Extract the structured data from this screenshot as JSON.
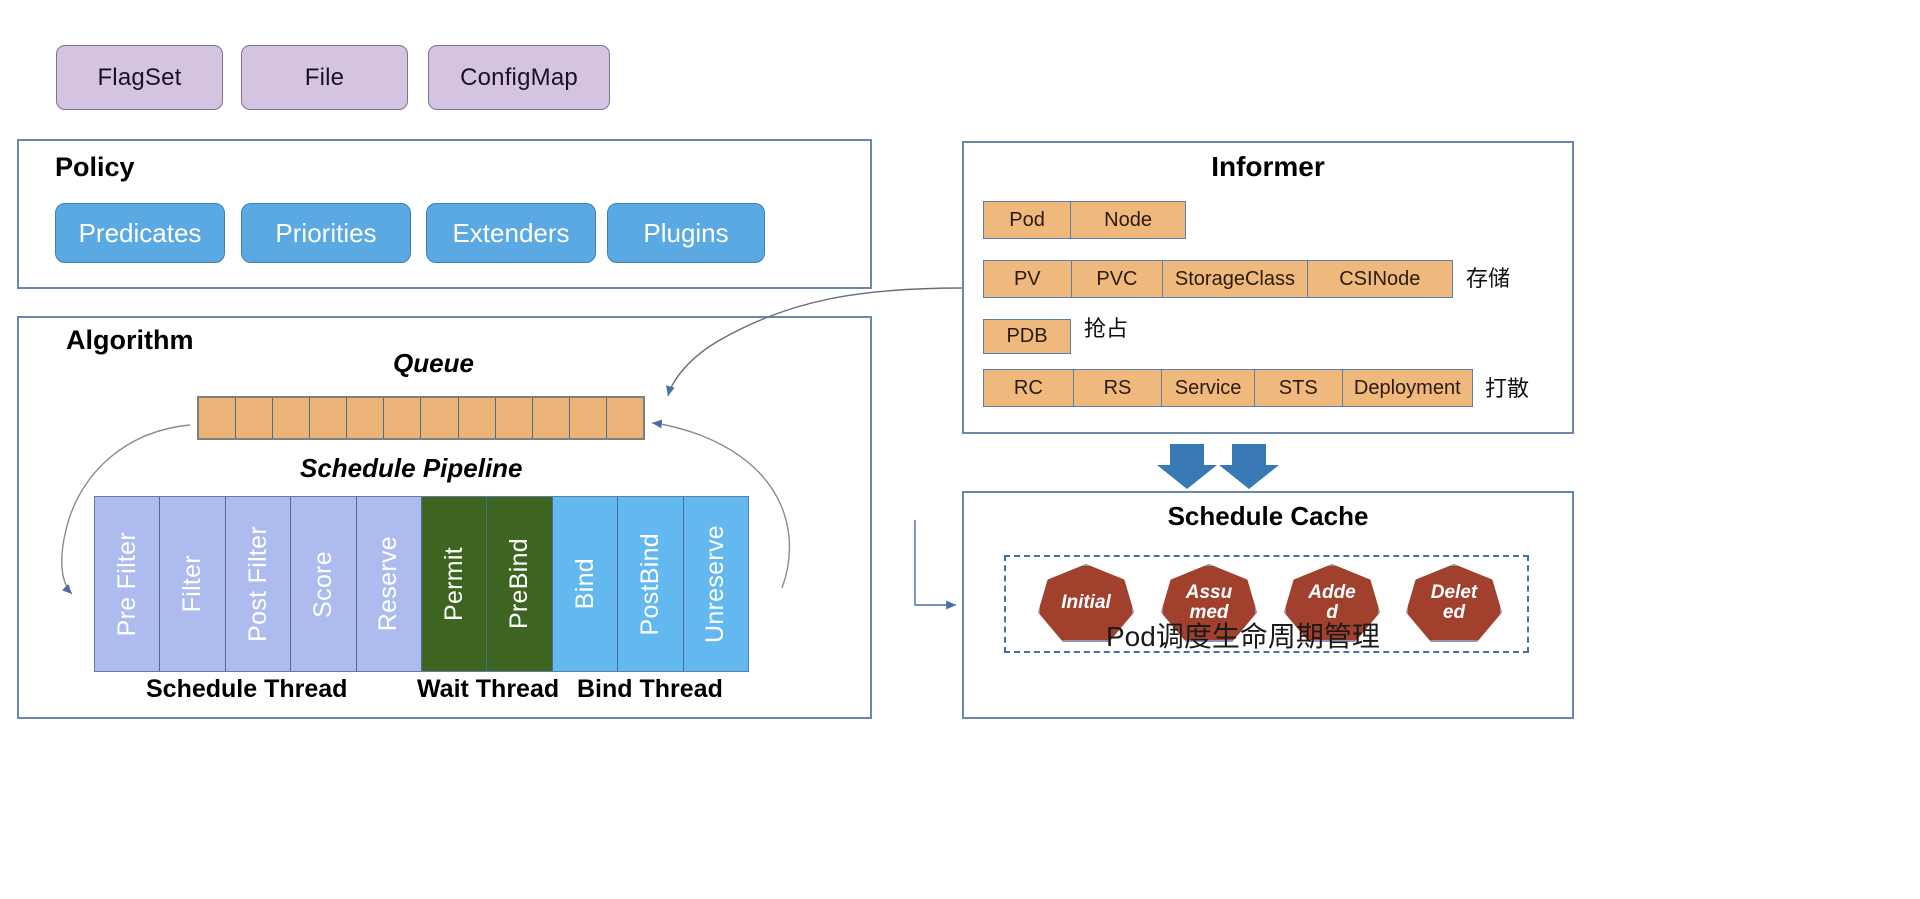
{
  "sources": {
    "chips": [
      {
        "label": "FlagSet"
      },
      {
        "label": "File"
      },
      {
        "label": "ConfigMap"
      }
    ]
  },
  "policy": {
    "title": "Policy",
    "chips": [
      {
        "label": "Predicates"
      },
      {
        "label": "Priorities"
      },
      {
        "label": "Extenders"
      },
      {
        "label": "Plugins"
      }
    ]
  },
  "algorithm": {
    "title": "Algorithm",
    "queue_caption": "Queue",
    "queue_cells": 12,
    "pipeline_caption": "Schedule Pipeline",
    "stages": [
      {
        "label": "Pre Filter",
        "group": "sched"
      },
      {
        "label": "Filter",
        "group": "sched"
      },
      {
        "label": "Post Filter",
        "group": "sched"
      },
      {
        "label": "Score",
        "group": "sched"
      },
      {
        "label": "Reserve",
        "group": "sched"
      },
      {
        "label": "Permit",
        "group": "wait"
      },
      {
        "label": "PreBind",
        "group": "wait"
      },
      {
        "label": "Bind",
        "group": "bind"
      },
      {
        "label": "PostBind",
        "group": "bind"
      },
      {
        "label": "Unreserve",
        "group": "bind"
      }
    ],
    "threads": [
      {
        "label": "Schedule Thread"
      },
      {
        "label": "Wait Thread"
      },
      {
        "label": "Bind Thread"
      }
    ]
  },
  "informer": {
    "title": "Informer",
    "rows": [
      {
        "cells": [
          "Pod",
          "Node"
        ],
        "note": ""
      },
      {
        "cells": [
          "PV",
          "PVC",
          "StorageClass",
          "CSINode"
        ],
        "note": "存储"
      },
      {
        "cells": [
          "PDB"
        ],
        "note": "抢占"
      },
      {
        "cells": [
          "RC",
          "RS",
          "Service",
          "STS",
          "Deployment"
        ],
        "note": "打散"
      }
    ]
  },
  "schedule_cache": {
    "title": "Schedule Cache",
    "states": [
      {
        "label": "Initial"
      },
      {
        "label": "Assu\nmed"
      },
      {
        "label": "Adde\nd"
      },
      {
        "label": "Delet\ned"
      }
    ],
    "caption": "Pod调度生命周期管理"
  },
  "colors": {
    "source_chip": "#d5c3e2",
    "policy_chip": "#5ba9e2",
    "frame_border": "#6c87ac",
    "queue_cell": "#ebb378",
    "resource_cell": "#efb97e",
    "stage_schedule": "#aebbee",
    "stage_wait": "#3d6421",
    "stage_bind": "#63b9ef",
    "heptagon": "#a0402d",
    "arrow_blue": "#3878b4"
  }
}
